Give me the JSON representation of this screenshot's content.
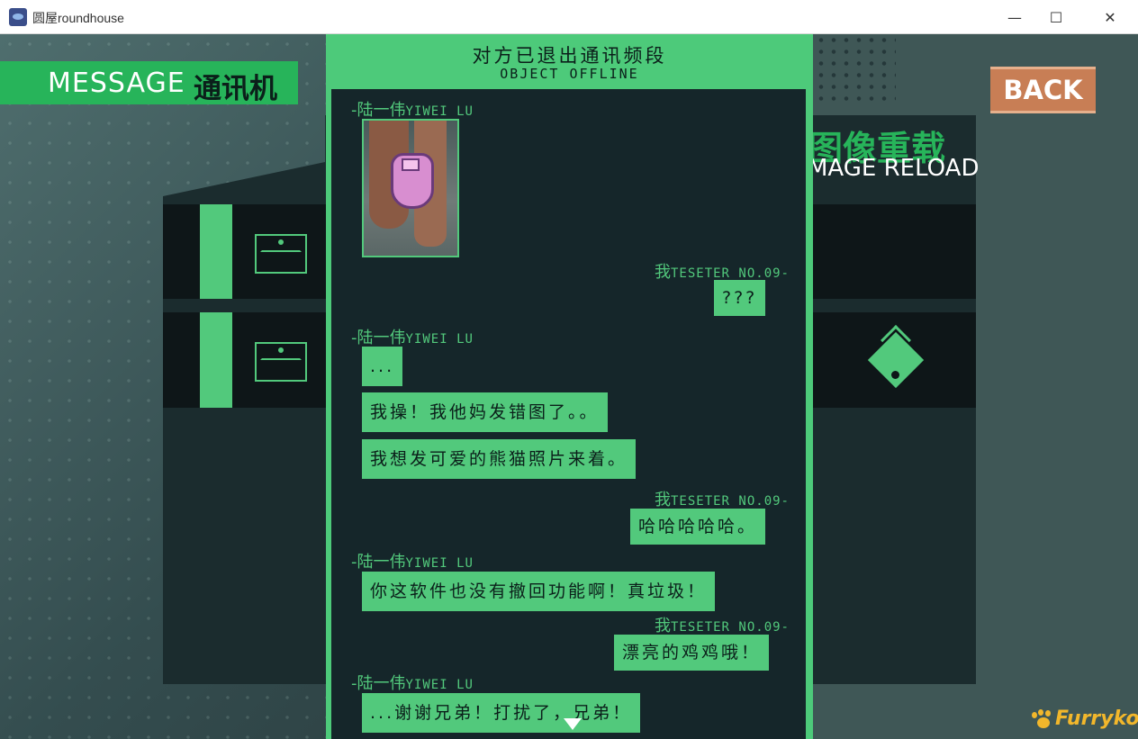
{
  "window": {
    "title": "圆屋roundhouse",
    "minimize_glyph": "—",
    "maximize_glyph": "☐",
    "close_glyph": "✕"
  },
  "header": {
    "label_en": "MESSAGE",
    "label_zh": "通讯机"
  },
  "back_button": {
    "label": "BACK"
  },
  "image_reload": {
    "label_zh": "图像重载",
    "label_en": "MAGE RELOAD"
  },
  "chat": {
    "title_zh": "对方已退出通讯频段",
    "title_en": "OBJECT OFFLINE",
    "messages": [
      {
        "sender_zh": "-陆一伟",
        "sender_en": "YIWEI LU"
      },
      {
        "sender_zh": "我",
        "sender_en": "TESETER NO.09-",
        "text": "???"
      },
      {
        "sender_zh": "-陆一伟",
        "sender_en": "YIWEI LU",
        "text": "..."
      },
      {
        "text": "我操！我他妈发错图了。。"
      },
      {
        "text": "我想发可爱的熊猫照片来着。"
      },
      {
        "sender_zh": "我",
        "sender_en": "TESETER NO.09-",
        "text": "哈哈哈哈哈。"
      },
      {
        "sender_zh": "-陆一伟",
        "sender_en": "YIWEI LU",
        "text": "你这软件也没有撤回功能啊！真垃圾！"
      },
      {
        "sender_zh": "我",
        "sender_en": "TESETER NO.09-",
        "text": "漂亮的鸡鸡哦！"
      },
      {
        "sender_zh": "-陆一伟",
        "sender_en": "YIWEI LU",
        "text": "...谢谢兄弟！打扰了，兄弟！"
      }
    ]
  },
  "logo": {
    "text": "Furrykong"
  },
  "colors": {
    "accent_green": "#52c97c",
    "header_green": "#27b45a",
    "back_orange": "#c87e55",
    "panel_dark": "#15262a",
    "logo_yellow": "#f2b72b"
  },
  "icons": [
    "envelope-icon",
    "diamond-pin-icon",
    "scroll-down-icon",
    "paw-icon"
  ]
}
